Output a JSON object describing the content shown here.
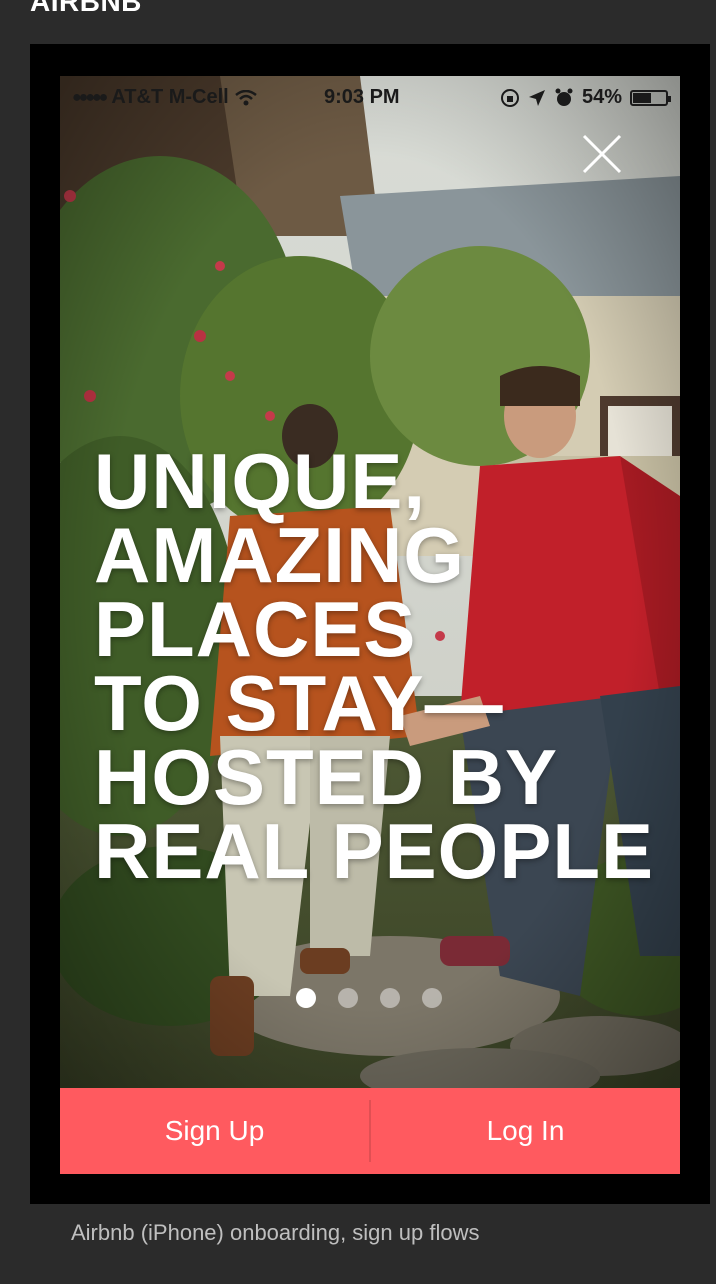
{
  "page": {
    "header": "AIRBNB",
    "caption": "Airbnb (iPhone) onboarding, sign up flows"
  },
  "status_bar": {
    "carrier": "AT&T M-Cell",
    "time": "9:03 PM",
    "battery": "54%",
    "battery_level": 0.54
  },
  "onboarding": {
    "headline": [
      "UNIQUE,",
      "AMAZING",
      "PLACES",
      "TO STAY—",
      "HOSTED BY",
      "REAL PEOPLE"
    ],
    "page_count": 4,
    "active_page": 1
  },
  "actions": {
    "sign_up": "Sign Up",
    "log_in": "Log In"
  },
  "colors": {
    "brand": "#ff5a5f",
    "background": "#2b2b2b"
  },
  "icons": [
    "close-icon",
    "wifi-icon",
    "location-icon",
    "alarm-icon",
    "lock-rotation-icon",
    "battery-icon"
  ]
}
